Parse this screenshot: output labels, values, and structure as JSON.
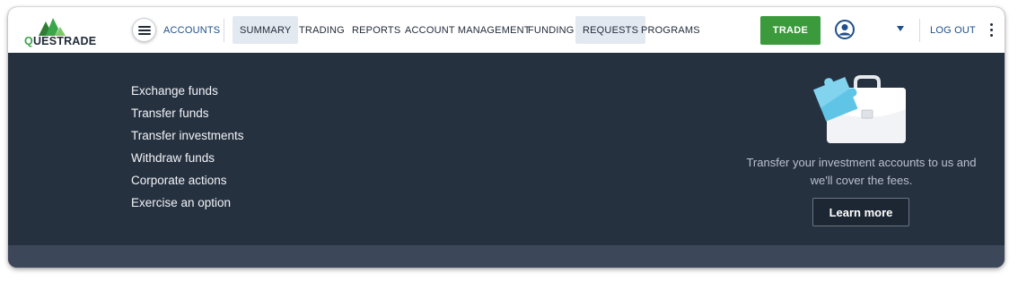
{
  "brand": {
    "logo_text": "QUESTRADE",
    "brand_color": "#3ba54a"
  },
  "nav": {
    "accounts": "ACCOUNTS",
    "items": [
      {
        "label": "SUMMARY",
        "active": true
      },
      {
        "label": "TRADING",
        "active": false
      },
      {
        "label": "REPORTS",
        "active": false
      },
      {
        "label": "ACCOUNT MANAGEMENT",
        "active": false
      },
      {
        "label": "FUNDING",
        "active": false
      },
      {
        "label": "REQUESTS",
        "active": true
      },
      {
        "label": "PROGRAMS",
        "active": false
      }
    ],
    "trade_label": "TRADE",
    "logout_label": "LOG OUT",
    "accent": "#1e4f8a",
    "trade_color": "#3a9a3c"
  },
  "panel": {
    "links": [
      "Exchange funds",
      "Transfer funds",
      "Transfer investments",
      "Withdraw funds",
      "Corporate actions",
      "Exercise an option"
    ],
    "promo_line1": "Transfer your investment accounts to us and",
    "promo_line2": "we'll cover the fees.",
    "learn_more_label": "Learn more",
    "background": "#263140"
  },
  "icons": {
    "menu": "hamburger-menu-icon",
    "avatar": "user-avatar-icon",
    "caret": "caret-down-icon",
    "more": "more-vertical-icon",
    "promo": "briefcase-puzzle-icon"
  }
}
